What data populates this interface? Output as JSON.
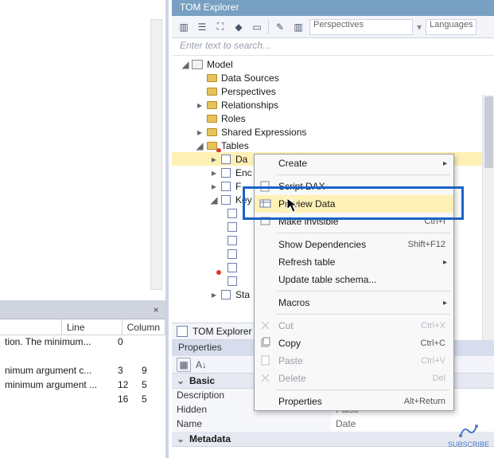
{
  "tom_title": "TOM Explorer",
  "toolbar": {
    "perspectives_label": "Perspectives",
    "languages_label": "Languages"
  },
  "search_placeholder": "Enter text to search...",
  "tree": {
    "model": "Model",
    "data_sources": "Data Sources",
    "perspectives": "Perspectives",
    "relationships": "Relationships",
    "roles": "Roles",
    "shared_expressions": "Shared Expressions",
    "tables": "Tables",
    "t_date": "Da",
    "t_enc": "Enc",
    "t_f": "F",
    "t_key": "Key",
    "t_sta": "Sta"
  },
  "context_menu": {
    "create": "Create",
    "script_dax": "Script DAX",
    "preview_data": "Preview Data",
    "make_invisible": "Make invisible",
    "make_invisible_shortcut": "Ctrl+I",
    "show_dependencies": "Show Dependencies",
    "show_dependencies_shortcut": "Shift+F12",
    "refresh_table": "Refresh table",
    "update_schema": "Update table schema...",
    "macros": "Macros",
    "cut": "Cut",
    "cut_shortcut": "Ctrl+X",
    "copy": "Copy",
    "copy_shortcut": "Ctrl+C",
    "paste": "Paste",
    "paste_shortcut": "Ctrl+V",
    "delete": "Delete",
    "delete_shortcut": "Del",
    "properties": "Properties",
    "properties_shortcut": "Alt+Return"
  },
  "tab_label": "TOM Explorer",
  "properties_panel": {
    "title": "Properties",
    "cat_basic": "Basic",
    "cat_metadata": "Metadata",
    "rows": {
      "description_k": "Description",
      "description_v": "",
      "hidden_k": "Hidden",
      "hidden_v": "False",
      "name_k": "Name",
      "name_v": "Date"
    }
  },
  "left_grid": {
    "col_line": "Line",
    "col_column": "Column",
    "rows": [
      {
        "desc": "tion. The minimum...",
        "line": "0",
        "col": ""
      },
      {
        "desc": "",
        "line": "",
        "col": ""
      },
      {
        "desc": "nimum argument c...",
        "line": "3",
        "col": "9"
      },
      {
        "desc": "minimum argument ...",
        "line": "12",
        "col": "5"
      },
      {
        "desc": "",
        "line": "16",
        "col": "5"
      }
    ]
  },
  "subscribe_label": "SUBSCRIBE"
}
